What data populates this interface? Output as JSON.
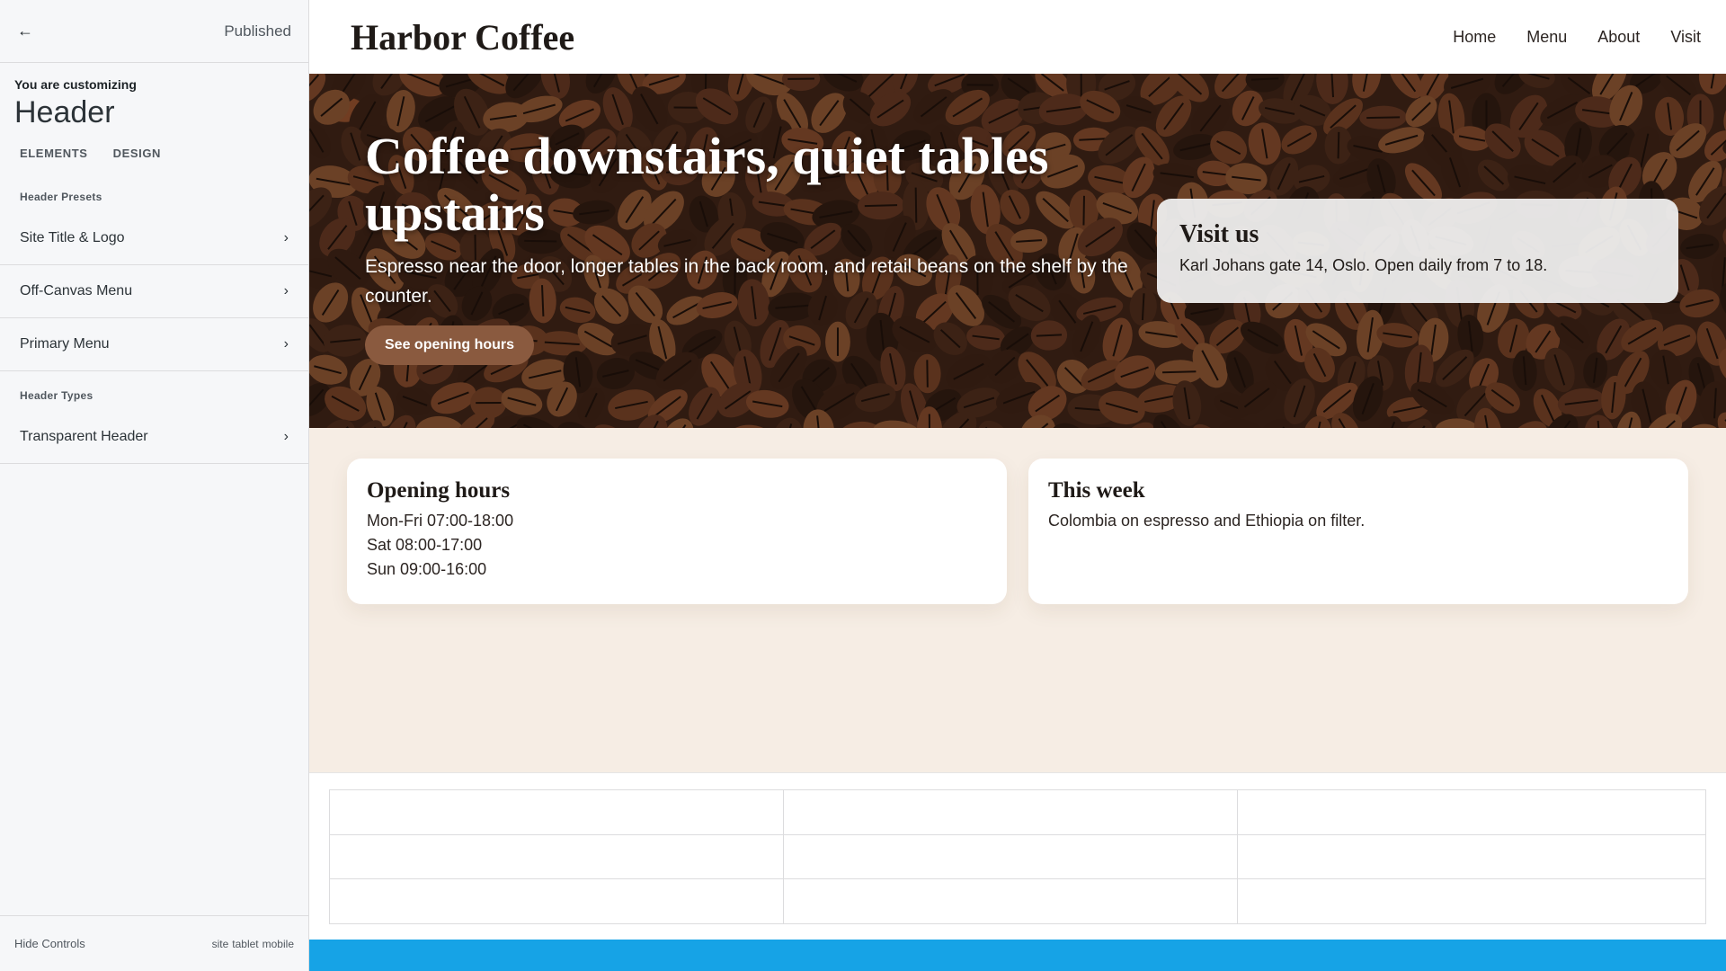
{
  "sidebar": {
    "back_icon": "back-arrow-icon",
    "back_glyph": "←",
    "status": "Published",
    "customizing_label": "You are customizing",
    "panel_title": "Header",
    "tabs": [
      "ELEMENTS",
      "DESIGN"
    ],
    "presets_title": "Header Presets",
    "preset_items": [
      "Site Title & Logo",
      "Off-Canvas Menu",
      "Primary Menu"
    ],
    "types_title": "Header Types",
    "type_items": [
      "Transparent Header"
    ],
    "chevron": "›",
    "footer": {
      "hide_controls": "Hide Controls",
      "devices": [
        "site",
        "tablet",
        "mobile"
      ]
    }
  },
  "site": {
    "title": "Harbor Coffee",
    "nav": [
      "Home",
      "Menu",
      "About",
      "Visit"
    ],
    "hero": {
      "title": "Coffee downstairs, quiet tables upstairs",
      "text": "Espresso near the door, longer tables in the back room, and retail beans on the shelf by the counter.",
      "button": "See opening hours"
    },
    "visit": {
      "title": "Visit us",
      "text": "Karl Johans gate 14, Oslo. Open daily from 7 to 18."
    },
    "hours": {
      "title": "Opening hours",
      "lines": [
        "Mon-Fri 07:00-18:00",
        "Sat 08:00-17:00",
        "Sun 09:00-16:00"
      ]
    },
    "week": {
      "title": "This week",
      "text": "Colombia on espresso and Ethiopia on filter."
    }
  },
  "colors": {
    "button_brown": "#8a5a3f",
    "cream_bg": "#f6ede4",
    "bottom_bar": "#16a3e6"
  }
}
